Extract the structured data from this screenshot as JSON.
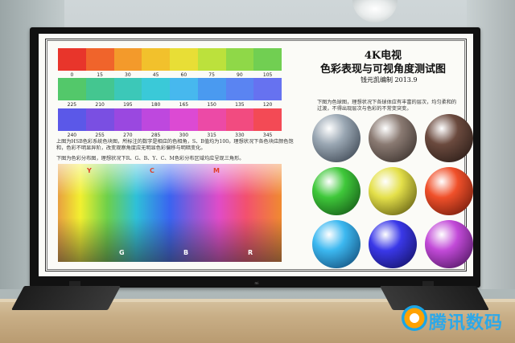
{
  "title_line1": "4K电视",
  "title_line2": "色彩表现与可视角度测试图",
  "author": "钱元凯编制 2013.9",
  "strip1": {
    "colors": [
      "#e8352b",
      "#f0642b",
      "#f39a2b",
      "#f2c12c",
      "#e8de36",
      "#bce13c",
      "#8fd848",
      "#71cf52"
    ],
    "labels": [
      "0",
      "15",
      "30",
      "45",
      "60",
      "75",
      "90",
      "105"
    ]
  },
  "strip2": {
    "colors": [
      "#53c86a",
      "#44c690",
      "#3cc8b8",
      "#3ac9d8",
      "#47b8ee",
      "#4a9af0",
      "#5a84f2",
      "#6672f0"
    ],
    "labels": [
      "225",
      "210",
      "195",
      "180",
      "165",
      "150",
      "135",
      "120"
    ]
  },
  "strip3": {
    "colors": [
      "#5b58e8",
      "#7a4fe2",
      "#9a48e0",
      "#be48de",
      "#dc4ad3",
      "#ec4aa6",
      "#f24b80",
      "#f34a55"
    ],
    "labels": [
      "240",
      "255",
      "270",
      "285",
      "300",
      "315",
      "330",
      "345"
    ]
  },
  "desc_strips": "上图为HSB色彩系统色块图，所标注的数字是相应的色相角，S、B值均为100。理想状况下各色块应颜色饱和，色彩不明显异阶，改变观察角度应无明显色彩偏移与明暗变化。",
  "desc_spectrum": "下图为色彩分布图，理想状况下R、G、B、Y、C、M色彩分布区域均应呈现三角形。",
  "spectrum_labels": {
    "y": "Y",
    "c": "C",
    "m": "M",
    "g": "G",
    "b": "B",
    "r": "R"
  },
  "desc_balls": "下图为色球图，理想状况下各球体应有丰富的层次，均匀柔和的过渡，不得出现层次与色彩的不常变突变。",
  "balls": [
    {
      "color": "#9aa7b3",
      "dark": "#2b3440"
    },
    {
      "color": "#8a7a72",
      "dark": "#2c2420"
    },
    {
      "color": "#6b4a3e",
      "dark": "#1e1410"
    },
    {
      "color": "#3fc83a",
      "dark": "#0d4410"
    },
    {
      "color": "#e4e04a",
      "dark": "#4a4608"
    },
    {
      "color": "#f0502a",
      "dark": "#5a1206"
    },
    {
      "color": "#3cb8f0",
      "dark": "#0c3b66"
    },
    {
      "color": "#3a38e8",
      "dark": "#0e0c50"
    },
    {
      "color": "#c24ad8",
      "dark": "#3c0e4c"
    }
  ],
  "watermark": "腾讯数码",
  "stand_logo": "mi"
}
